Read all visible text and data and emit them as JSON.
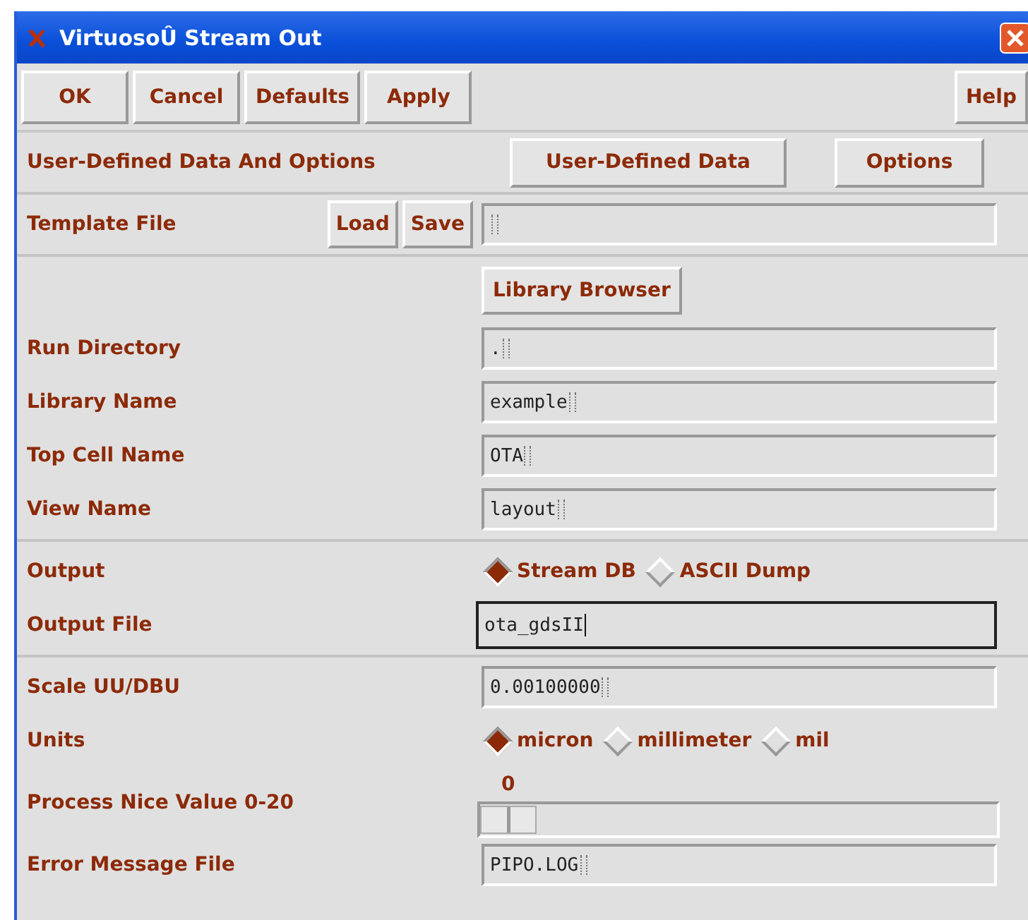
{
  "window": {
    "title": "VirtuosoÛ Stream Out"
  },
  "toolbar": {
    "buttons": [
      "OK",
      "Cancel",
      "Defaults",
      "Apply"
    ],
    "help": "Help"
  },
  "sections": [
    {
      "rows": [
        {
          "kind": "buttons",
          "label": "User-Defined Data And Options",
          "buttons": [
            "User-Defined Data",
            "Options"
          ]
        }
      ]
    },
    {
      "rows": [
        {
          "kind": "template",
          "label": "Template File",
          "buttons": [
            "Load",
            "Save"
          ],
          "value": "",
          "focused": false
        }
      ]
    },
    {
      "rows": [
        {
          "kind": "button",
          "button": "Library Browser"
        },
        {
          "kind": "field",
          "label": "Run Directory",
          "value": ".",
          "focused": false
        },
        {
          "kind": "field",
          "label": "Library Name",
          "value": "example",
          "focused": false
        },
        {
          "kind": "field",
          "label": "Top Cell Name",
          "value": "OTA",
          "focused": false
        },
        {
          "kind": "field",
          "label": "View Name",
          "value": "layout",
          "focused": false
        }
      ]
    },
    {
      "rows": [
        {
          "kind": "radio",
          "label": "Output",
          "options": [
            {
              "label": "Stream DB",
              "selected": true
            },
            {
              "label": "ASCII Dump",
              "selected": false
            }
          ]
        },
        {
          "kind": "field",
          "label": "Output File",
          "value": "ota_gdsII",
          "focused": true
        }
      ]
    },
    {
      "rows": [
        {
          "kind": "field",
          "label": "Scale UU/DBU",
          "value": "0.00100000",
          "focused": false
        },
        {
          "kind": "radio",
          "label": "Units",
          "options": [
            {
              "label": "micron",
              "selected": true
            },
            {
              "label": "millimeter",
              "selected": false
            },
            {
              "label": "mil",
              "selected": false
            }
          ]
        },
        {
          "kind": "slider",
          "label": "Process Nice Value 0-20",
          "reading": "0",
          "level": 0
        },
        {
          "kind": "field",
          "label": "Error Message File",
          "value": "PIPO.LOG",
          "focused": false
        }
      ]
    }
  ]
}
